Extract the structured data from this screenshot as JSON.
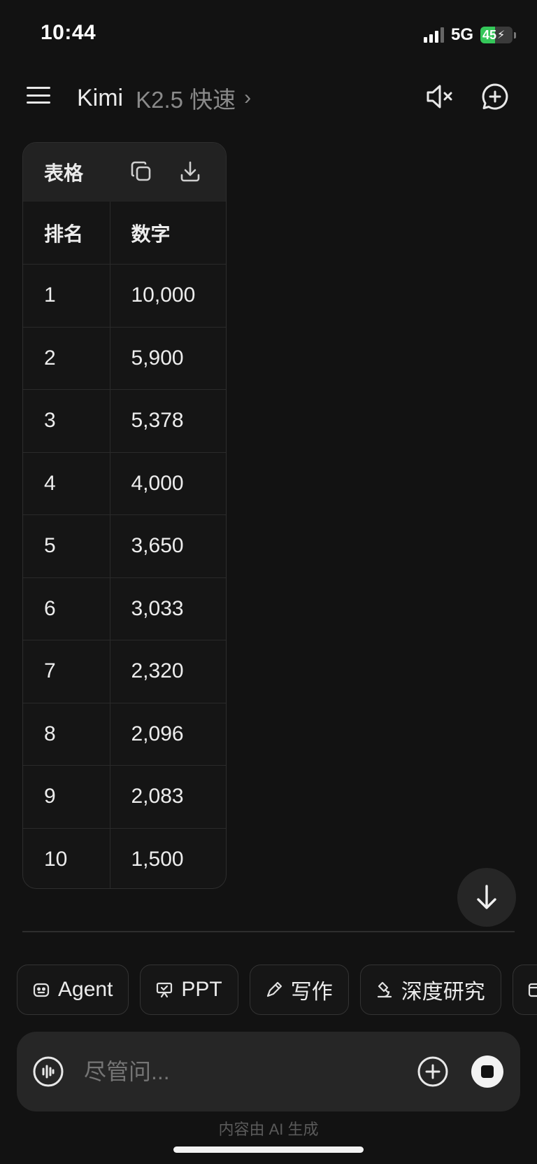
{
  "status_bar": {
    "time": "10:44",
    "network": "5G",
    "battery": "45"
  },
  "header": {
    "app_name": "Kimi",
    "model": "K2.5 快速",
    "chevron": "›"
  },
  "table": {
    "title": "表格",
    "columns": [
      "排名",
      "数字"
    ],
    "rows": [
      [
        "1",
        "10,000"
      ],
      [
        "2",
        "5,900"
      ],
      [
        "3",
        "5,378"
      ],
      [
        "4",
        "4,000"
      ],
      [
        "5",
        "3,650"
      ],
      [
        "6",
        "3,033"
      ],
      [
        "7",
        "2,320"
      ],
      [
        "8",
        "2,096"
      ],
      [
        "9",
        "2,083"
      ],
      [
        "10",
        "1,500"
      ]
    ]
  },
  "chips": [
    {
      "label": "Agent",
      "icon": "robot-icon"
    },
    {
      "label": "PPT",
      "icon": "presentation-icon"
    },
    {
      "label": "写作",
      "icon": "pen-icon"
    },
    {
      "label": "深度研究",
      "icon": "microscope-icon"
    }
  ],
  "input": {
    "placeholder": "尽管问..."
  },
  "footer": {
    "disclaimer": "内容由 AI 生成"
  },
  "colors": {
    "background": "#121212",
    "battery_green": "#34c759",
    "surface": "#262626"
  }
}
